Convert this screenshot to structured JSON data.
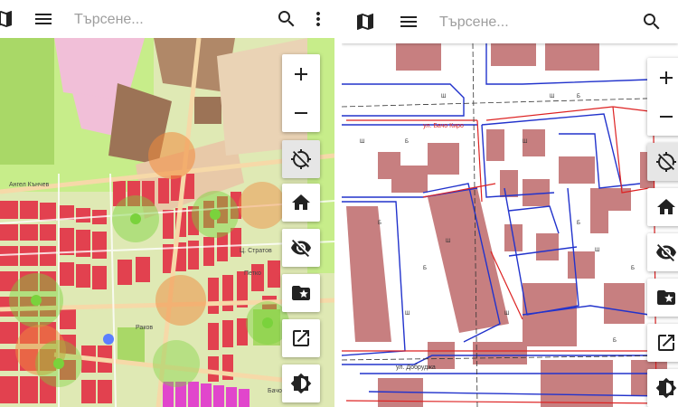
{
  "left": {
    "search": {
      "placeholder": "Търсене..."
    },
    "icons": {
      "map": "map-icon",
      "menu": "menu-icon",
      "search": "search-icon",
      "more": "more-vert-icon"
    },
    "controls": [
      "zoom-in-icon",
      "zoom-out-icon",
      "gps-off-icon",
      "home-icon",
      "visibility-off-icon",
      "folder-star-icon",
      "open-in-new-icon",
      "brightness-icon"
    ],
    "map_labels": [
      "Ангел Кънчев",
      "Ц. Стратов",
      "Петко",
      "Раков",
      "Бачо"
    ]
  },
  "right": {
    "search": {
      "placeholder": "Търсене..."
    },
    "icons": {
      "map": "map-icon",
      "menu": "menu-icon",
      "search": "search-icon"
    },
    "map_labels": [
      "ул. Бачо Киро",
      "ул. Добруджа"
    ]
  },
  "colors": {
    "park": "#c7ed8a",
    "residential": "#e2414f",
    "industrial": "#9c7356",
    "pink": "#f1bfd8",
    "magenta": "#e146cc",
    "orange_circle": "#f08a3e",
    "green_circle": "#7ad23c",
    "building_pink": "#c77f80",
    "cadastre_blue": "#2233cc",
    "cadastre_red": "#dd2222"
  }
}
